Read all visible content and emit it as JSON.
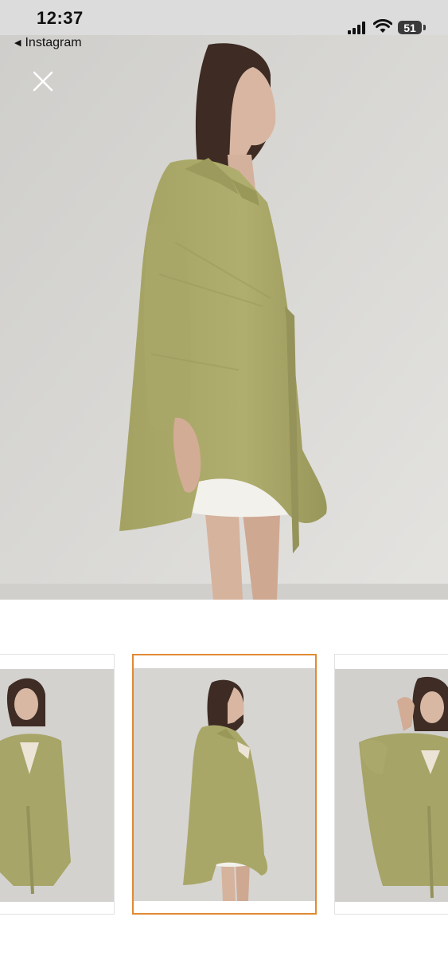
{
  "status_bar": {
    "time": "12:37",
    "back_app": "Instagram",
    "battery": "51",
    "signal_icon": "cellular-signal-icon",
    "wifi_icon": "wifi-icon",
    "battery_icon": "battery-icon"
  },
  "viewer": {
    "close_icon": "close-icon",
    "selected_index": 1,
    "thumbnail_count": 3
  },
  "colors": {
    "accent_border": "#e08a34",
    "garment": "#a7a665",
    "backdrop": "#d4d3d1"
  }
}
